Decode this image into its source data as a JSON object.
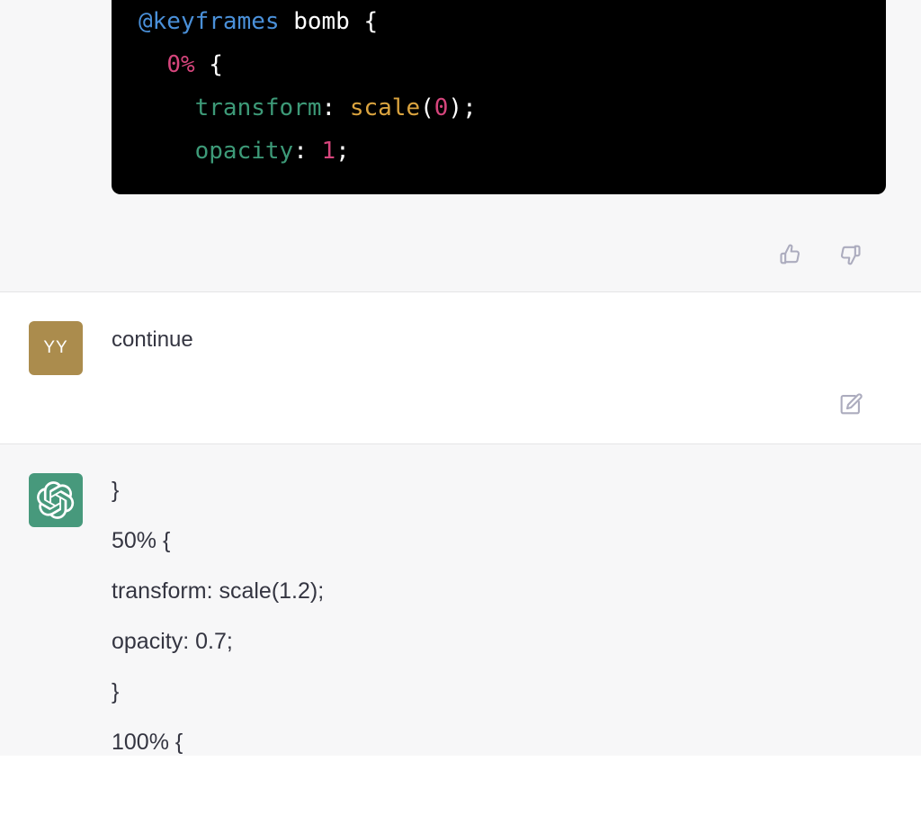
{
  "conversation": {
    "messages": [
      {
        "role": "assistant",
        "kind": "code",
        "code_language": "css",
        "code_lines": [
          {
            "tokens": [
              {
                "text": "@keyframes ",
                "type": "at-rule"
              },
              {
                "text": "bomb",
                "type": "plain"
              },
              {
                "text": " {",
                "type": "punct"
              }
            ]
          },
          {
            "tokens": [
              {
                "text": "  ",
                "type": "punct"
              },
              {
                "text": "0%",
                "type": "percent"
              },
              {
                "text": " {",
                "type": "punct"
              }
            ]
          },
          {
            "tokens": [
              {
                "text": "    ",
                "type": "punct"
              },
              {
                "text": "transform",
                "type": "property"
              },
              {
                "text": ": ",
                "type": "punct"
              },
              {
                "text": "scale",
                "type": "function"
              },
              {
                "text": "(",
                "type": "punct"
              },
              {
                "text": "0",
                "type": "number"
              },
              {
                "text": ");",
                "type": "punct"
              }
            ]
          },
          {
            "tokens": [
              {
                "text": "    ",
                "type": "punct"
              },
              {
                "text": "opacity",
                "type": "property"
              },
              {
                "text": ": ",
                "type": "punct"
              },
              {
                "text": "1",
                "type": "number"
              },
              {
                "text": ";",
                "type": "punct"
              }
            ]
          }
        ],
        "actions": [
          {
            "name": "thumbs-up",
            "label": "Good response"
          },
          {
            "name": "thumbs-down",
            "label": "Bad response"
          }
        ]
      },
      {
        "role": "user",
        "avatar_initials": "YY",
        "avatar_color": "#ab8c4d",
        "text": "continue",
        "actions": [
          {
            "name": "edit",
            "label": "Edit message"
          }
        ]
      },
      {
        "role": "assistant",
        "avatar_color": "#47997c",
        "kind": "text",
        "lines": [
          "}",
          "50% {",
          "transform: scale(1.2);",
          "opacity: 0.7;",
          "}",
          "100% {"
        ]
      }
    ]
  },
  "theme": {
    "assistant_bg": "#f7f7f8",
    "user_bg": "#ffffff",
    "text_color": "#343541",
    "divider": "#e5e5e6",
    "code_bg": "#000000",
    "icon_color": "#acacbe",
    "syntax": {
      "at_rule": "#4a90d9",
      "percent": "#d6457c",
      "property": "#3d9a78",
      "function": "#dba43f",
      "number": "#d6457c",
      "plain": "#ffffff"
    }
  }
}
